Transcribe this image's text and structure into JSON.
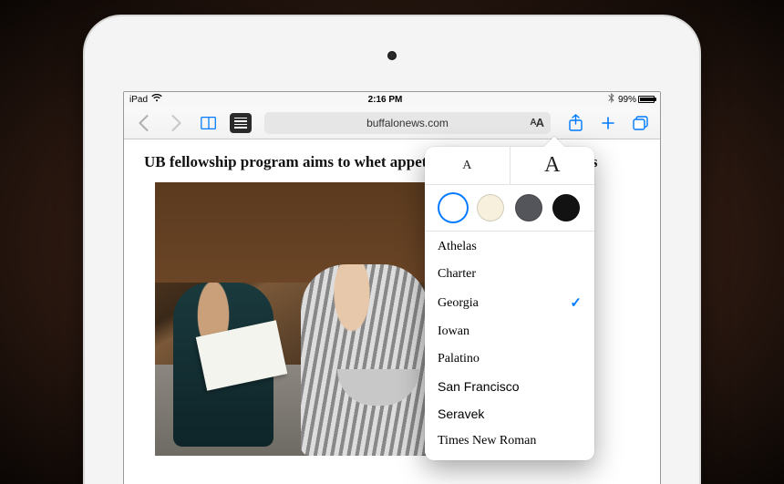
{
  "status": {
    "carrier": "iPad",
    "time": "2:16 PM",
    "battery_pct": "99%"
  },
  "toolbar": {
    "url": "buffalonews.com",
    "aa_small": "A",
    "aa_large": "A"
  },
  "article": {
    "headline": "UB fellowship program aims to whet appetite in high school students"
  },
  "reader_popover": {
    "size_small_label": "A",
    "size_large_label": "A",
    "themes": [
      {
        "name": "white",
        "color": "#ffffff",
        "selected": true
      },
      {
        "name": "sepia",
        "color": "#f6f0dc",
        "selected": false
      },
      {
        "name": "gray",
        "color": "#54555a",
        "selected": false
      },
      {
        "name": "black",
        "color": "#121212",
        "selected": false
      }
    ],
    "fonts": [
      {
        "label": "Athelas",
        "css": "f-athelas",
        "selected": false
      },
      {
        "label": "Charter",
        "css": "f-charter",
        "selected": false
      },
      {
        "label": "Georgia",
        "css": "f-georgia",
        "selected": true
      },
      {
        "label": "Iowan",
        "css": "f-iowan",
        "selected": false
      },
      {
        "label": "Palatino",
        "css": "f-palatino",
        "selected": false
      },
      {
        "label": "San Francisco",
        "css": "f-sf",
        "selected": false
      },
      {
        "label": "Seravek",
        "css": "f-seravek",
        "selected": false
      },
      {
        "label": "Times New Roman",
        "css": "f-tnr",
        "selected": false
      }
    ],
    "checkmark": "✓"
  }
}
